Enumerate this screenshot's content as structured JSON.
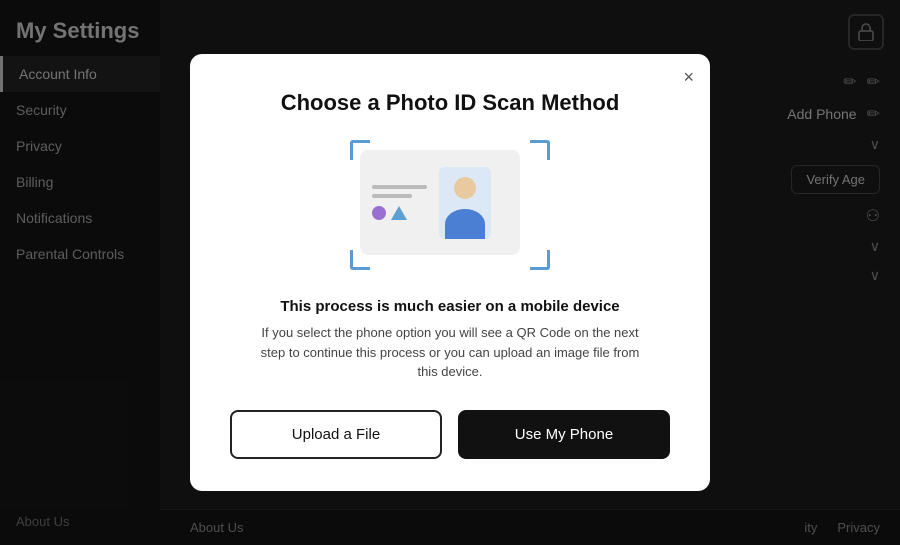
{
  "app": {
    "title": "My Settings"
  },
  "sidebar": {
    "items": [
      {
        "id": "account-info",
        "label": "Account Info",
        "active": true
      },
      {
        "id": "security",
        "label": "Security",
        "active": false
      },
      {
        "id": "privacy",
        "label": "Privacy",
        "active": false
      },
      {
        "id": "billing",
        "label": "Billing",
        "active": false
      },
      {
        "id": "notifications",
        "label": "Notifications",
        "active": false
      },
      {
        "id": "parental-controls",
        "label": "Parental Controls",
        "active": false
      }
    ],
    "footer_label": "About Us"
  },
  "main": {
    "add_phone_label": "Add Phone",
    "verify_age_label": "Verify Age"
  },
  "footer": {
    "links": [
      "About Us",
      "ity",
      "Privacy"
    ]
  },
  "modal": {
    "title": "Choose a Photo ID Scan Method",
    "hint_title": "This process is much easier on a mobile device",
    "hint_body": "If you select the phone option you will see a QR Code on the next step to continue this process or you can upload an image file from this device.",
    "upload_label": "Upload a File",
    "phone_label": "Use My Phone",
    "close_label": "×"
  }
}
